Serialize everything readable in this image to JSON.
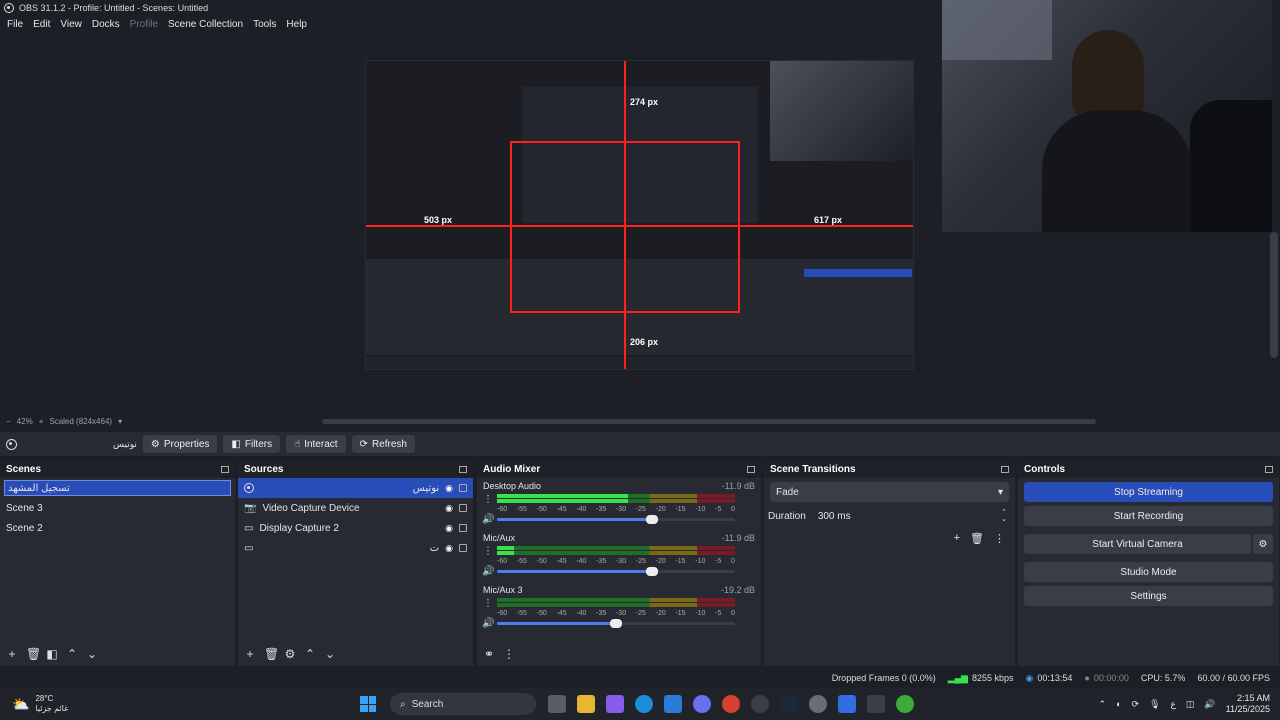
{
  "window": {
    "title": "OBS 31.1.2 - Profile: Untitled - Scenes: Untitled"
  },
  "menu": [
    "File",
    "Edit",
    "View",
    "Docks",
    "Profile",
    "Scene Collection",
    "Tools",
    "Help"
  ],
  "preview": {
    "zoom": "42%",
    "scale_label": "Scaled (824x464)",
    "annotations": [
      "274 px",
      "503 px",
      "617 px",
      "206 px"
    ]
  },
  "toolbar": {
    "source_name": "نوتيس",
    "properties": "Properties",
    "filters": "Filters",
    "interact": "Interact",
    "refresh": "Refresh"
  },
  "scenes": {
    "title": "Scenes",
    "items": [
      "تسجيل المشهد",
      "Scene 3",
      "Scene 2"
    ]
  },
  "sources": {
    "title": "Sources",
    "items": [
      {
        "name": "نوتيس",
        "icon": "browser-icon"
      },
      {
        "name": "Video Capture Device",
        "icon": "camera-icon"
      },
      {
        "name": "Display Capture 2",
        "icon": "monitor-icon"
      },
      {
        "name": "ت",
        "icon": "monitor-icon"
      }
    ]
  },
  "mixer": {
    "title": "Audio Mixer",
    "ticks": [
      "-60",
      "-55",
      "-50",
      "-45",
      "-40",
      "-35",
      "-30",
      "-25",
      "-20",
      "-15",
      "-10",
      "-5",
      "0"
    ],
    "channels": [
      {
        "name": "Desktop Audio",
        "db": "-11.9 dB",
        "level": 0.55,
        "volume": 0.65
      },
      {
        "name": "Mic/Aux",
        "db": "-11.9 dB",
        "level": 0.07,
        "volume": 0.65
      },
      {
        "name": "Mic/Aux 3",
        "db": "-19.2 dB",
        "level": 0.0,
        "volume": 0.5
      }
    ]
  },
  "transitions": {
    "title": "Scene Transitions",
    "selected": "Fade",
    "duration_label": "Duration",
    "duration_value": "300 ms"
  },
  "controls": {
    "title": "Controls",
    "stop_streaming": "Stop Streaming",
    "start_recording": "Start Recording",
    "start_virtual_camera": "Start Virtual Camera",
    "studio_mode": "Studio Mode",
    "settings": "Settings"
  },
  "status": {
    "dropped_frames": "Dropped Frames 0 (0.0%)",
    "bitrate": "8255 kbps",
    "stream_time": "00:13:54",
    "record_time": "00:00:00",
    "cpu": "CPU: 5.7%",
    "fps": "60.00 / 60.00 FPS"
  },
  "taskbar": {
    "weather_temp": "28°C",
    "weather_desc": "غائم جزئيا",
    "search": "Search",
    "time": "2:15 AM",
    "date": "11/25/2025",
    "lang": "ع"
  },
  "colors": {
    "accent": "#284cb8",
    "bg": "#1d1f26",
    "panel": "#272a33",
    "annotation": "#ff1f1f"
  }
}
